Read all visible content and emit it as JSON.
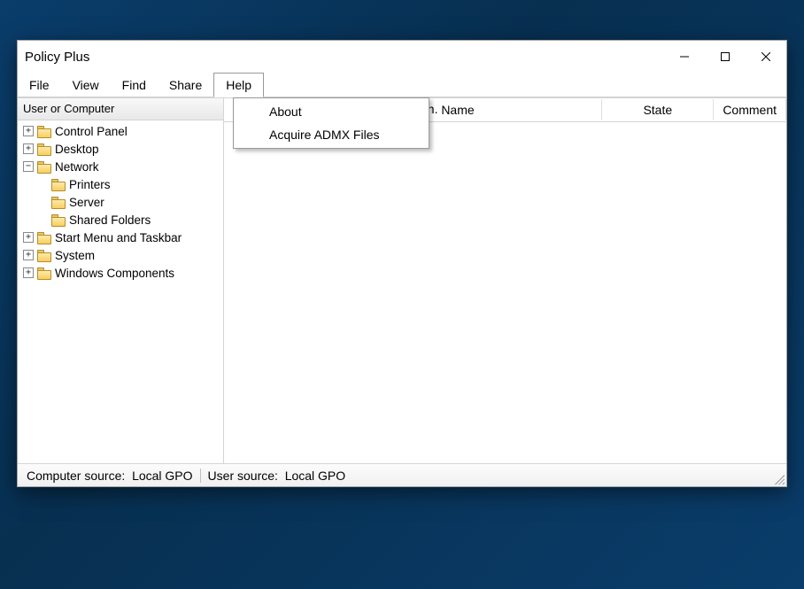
{
  "window": {
    "title": "Policy Plus"
  },
  "menubar": {
    "items": [
      "File",
      "View",
      "Find",
      "Share",
      "Help"
    ],
    "open_index": 4
  },
  "help_menu": {
    "items": [
      "About",
      "Acquire ADMX Files"
    ]
  },
  "tree": {
    "header": "User or Computer",
    "nodes": [
      {
        "label": "Control Panel",
        "expandable": true,
        "depth": 0
      },
      {
        "label": "Desktop",
        "expandable": true,
        "depth": 0
      },
      {
        "label": "Network",
        "expandable": true,
        "depth": 0,
        "expanded": true
      },
      {
        "label": "Printers",
        "expandable": false,
        "depth": 1
      },
      {
        "label": "Server",
        "expandable": false,
        "depth": 1
      },
      {
        "label": "Shared Folders",
        "expandable": false,
        "depth": 1
      },
      {
        "label": "Start Menu and Taskbar",
        "expandable": true,
        "depth": 0
      },
      {
        "label": "System",
        "expandable": true,
        "depth": 0
      },
      {
        "label": "Windows Components",
        "expandable": true,
        "depth": 0
      }
    ]
  },
  "list": {
    "columns": {
      "name": "Name",
      "state": "State",
      "comment": "Comment"
    },
    "partial_behind_menu": "on."
  },
  "statusbar": {
    "computer_source_label": "Computer source:",
    "computer_source_value": "Local GPO",
    "user_source_label": "User source:",
    "user_source_value": "Local GPO"
  }
}
